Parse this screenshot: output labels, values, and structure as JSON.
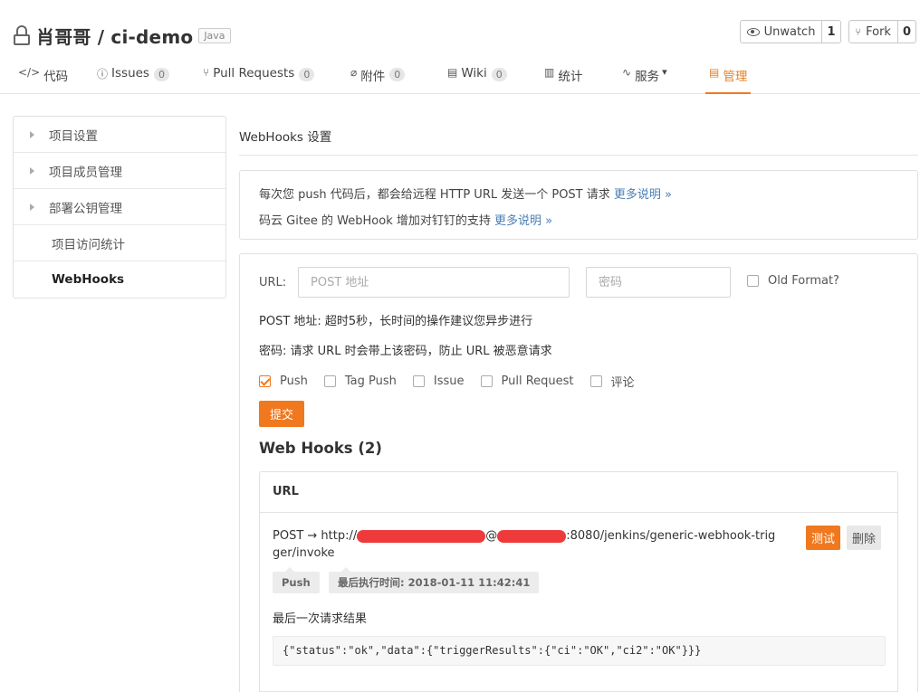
{
  "repo": {
    "title": "肖哥哥 / ci-demo",
    "language": "Java"
  },
  "actions": {
    "watch_label": "Unwatch",
    "watch_count": "1",
    "fork_label": "Fork",
    "fork_count": "0"
  },
  "tabs": [
    {
      "label": "代码",
      "icon": "code-icon",
      "glyph": "</>",
      "badge": ""
    },
    {
      "label": "Issues",
      "icon": "issue-icon",
      "glyph": "ⓘ",
      "badge": "0"
    },
    {
      "label": "Pull Requests",
      "icon": "pull-request-icon",
      "glyph": "⑂",
      "badge": "0"
    },
    {
      "label": "附件",
      "icon": "paperclip-icon",
      "glyph": "⌀",
      "badge": "0"
    },
    {
      "label": "Wiki",
      "icon": "book-icon",
      "glyph": "▤",
      "badge": "0"
    },
    {
      "label": "统计",
      "icon": "bar-chart-icon",
      "glyph": "▥",
      "badge": ""
    },
    {
      "label": "服务",
      "icon": "pulse-icon",
      "glyph": "∿",
      "badge": "",
      "dropdown": "▾"
    },
    {
      "label": "管理",
      "icon": "manage-icon",
      "glyph": "▤",
      "badge": "",
      "active": true
    }
  ],
  "sidebar": {
    "items": [
      {
        "label": "项目设置",
        "expandable": true
      },
      {
        "label": "项目成员管理",
        "expandable": true
      },
      {
        "label": "部署公钥管理",
        "expandable": true
      },
      {
        "label": "项目访问统计",
        "expandable": false
      },
      {
        "label": "WebHooks",
        "expandable": false,
        "active": true
      }
    ]
  },
  "main": {
    "title": "WebHooks 设置",
    "info": {
      "line1": "每次您 push 代码后，都会给远程 HTTP URL 发送一个 POST 请求 ",
      "line1_link": "更多说明 »",
      "line2": "码云 Gitee 的 WebHook 增加对钉钉的支持 ",
      "line2_link": "更多说明 »"
    },
    "form": {
      "url_label": "URL:",
      "url_placeholder": "POST 地址",
      "password_placeholder": "密码",
      "old_format_label": "Old Format?",
      "hint_post": "POST 地址: 超时5秒，长时间的操作建议您异步进行",
      "hint_password": "密码: 请求 URL 时会带上该密码，防止 URL 被恶意请求",
      "events": [
        {
          "label": "Push",
          "checked": true
        },
        {
          "label": "Tag Push",
          "checked": false
        },
        {
          "label": "Issue",
          "checked": false
        },
        {
          "label": "Pull Request",
          "checked": false
        },
        {
          "label": "评论",
          "checked": false
        }
      ],
      "submit_label": "提交"
    },
    "hooks": {
      "title": "Web Hooks (2)",
      "column_header": "URL",
      "items": [
        {
          "url_prefix": "POST → http://",
          "url_mid": "@",
          "url_suffix": ":8080/jenkins/generic-webhook-trigger/invoke",
          "test_label": "测试",
          "delete_label": "删除",
          "tag_event": "Push",
          "tag_time": "最后执行时间: 2018-01-11 11:42:41",
          "result_label": "最后一次请求结果",
          "result": "{\"status\":\"ok\",\"data\":{\"triggerResults\":{\"ci\":\"OK\",\"ci2\":\"OK\"}}}"
        }
      ]
    }
  },
  "colors": {
    "accent": "#f0781e",
    "link": "#4a7fb5",
    "redaction": "#ee3a3a"
  }
}
